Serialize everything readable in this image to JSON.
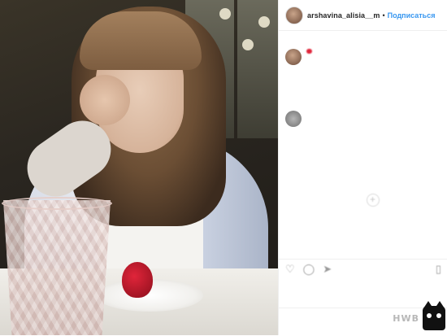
{
  "post": {
    "photo_alt": "photo",
    "comments": [
      {
        "text": "",
        "has_heart": true,
        "time": ""
      },
      {
        "text": "",
        "has_heart": false,
        "time": ""
      }
    ],
    "likes_text": "",
    "posted_text": ""
  },
  "header": {
    "username": "arshavina_alisia__m",
    "separator": "•",
    "follow_label": "Подписаться"
  },
  "actions": {
    "like_icon": "heart-icon",
    "comment_icon": "comment-icon",
    "share_icon": "share-icon",
    "save_icon": "bookmark-icon"
  },
  "watermark": {
    "text": "HWB"
  }
}
